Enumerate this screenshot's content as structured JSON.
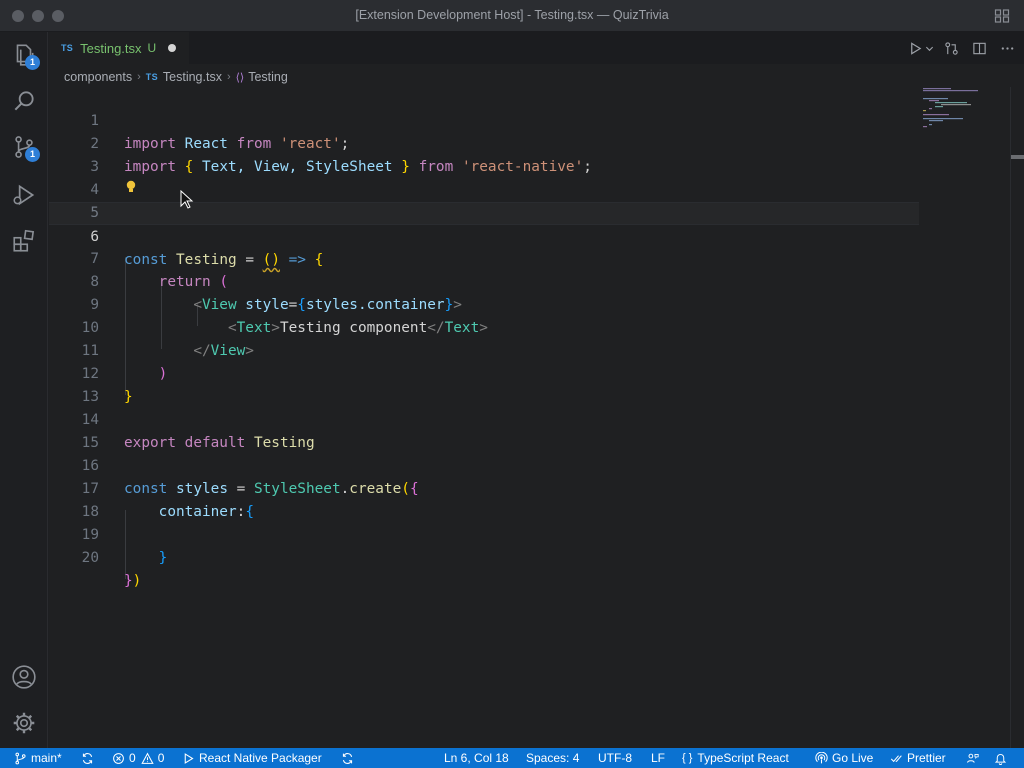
{
  "window": {
    "title": "[Extension Development Host] - Testing.tsx — QuizTrivia"
  },
  "activity_bar": {
    "explorer_badge": "1",
    "source_control_badge": "1"
  },
  "tab": {
    "lang_badge": "TS",
    "filename": "Testing.tsx",
    "status": "U"
  },
  "breadcrumb": {
    "folder": "components",
    "file_badge": "TS",
    "file": "Testing.tsx",
    "symbol": "Testing"
  },
  "line_numbers": [
    "1",
    "2",
    "3",
    "4",
    "5",
    "6",
    "7",
    "8",
    "9",
    "10",
    "11",
    "12",
    "13",
    "14",
    "15",
    "16",
    "17",
    "18",
    "19",
    "20"
  ],
  "code": {
    "l1": {
      "import": "import",
      "react_id": "React",
      "from": "from",
      "str": "'react'",
      "semi": ";"
    },
    "l2": {
      "import": "import",
      "open": "{",
      "names": " Text, View, StyleSheet ",
      "close": "}",
      "from": "from",
      "str": "'react-native'",
      "semi": ";"
    },
    "l6": {
      "const": "const",
      "name": "Testing",
      "eq": " = ",
      "parens": "()",
      "arrow": " => ",
      "brace": "{"
    },
    "l7": {
      "return": "return",
      "paren": "("
    },
    "l8": {
      "lt": "<",
      "tag": "View",
      "attr": " style",
      "eq": "=",
      "open": "{",
      "expr": "styles.container",
      "close": "}",
      "gt": ">"
    },
    "l9": {
      "lt": "<",
      "tag": "Text",
      "gt": ">",
      "text": "Testing component",
      "lt2": "</",
      "tag2": "Text",
      "gt2": ">"
    },
    "l10": {
      "lt": "</",
      "tag": "View",
      "gt": ">"
    },
    "l11": {
      "paren": ")"
    },
    "l12": {
      "brace": "}"
    },
    "l14": {
      "export": "export",
      "default": "default",
      "name": "Testing"
    },
    "l16": {
      "const": "const",
      "name": "styles",
      "eq": " = ",
      "cls": "StyleSheet",
      "dot": ".",
      "fn": "create",
      "paren": "(",
      "brace": "{"
    },
    "l17": {
      "key": "container",
      "colon": ":",
      "brace": "{"
    },
    "l19": {
      "brace": "}"
    },
    "l20": {
      "brace": "}",
      "paren": ")"
    }
  },
  "status_bar": {
    "branch": "main*",
    "errors": "0",
    "warnings": "0",
    "packager": "React Native Packager",
    "position": "Ln 6, Col 18",
    "spaces": "Spaces: 4",
    "encoding": "UTF-8",
    "eol": "LF",
    "language_braces": "{ }",
    "language": "TypeScript React",
    "go_live": "Go Live",
    "prettier": "Prettier"
  },
  "colors": {
    "status_bar": "#0b72d1",
    "badge": "#2f7fd7",
    "untracked_file": "#78c26e"
  }
}
